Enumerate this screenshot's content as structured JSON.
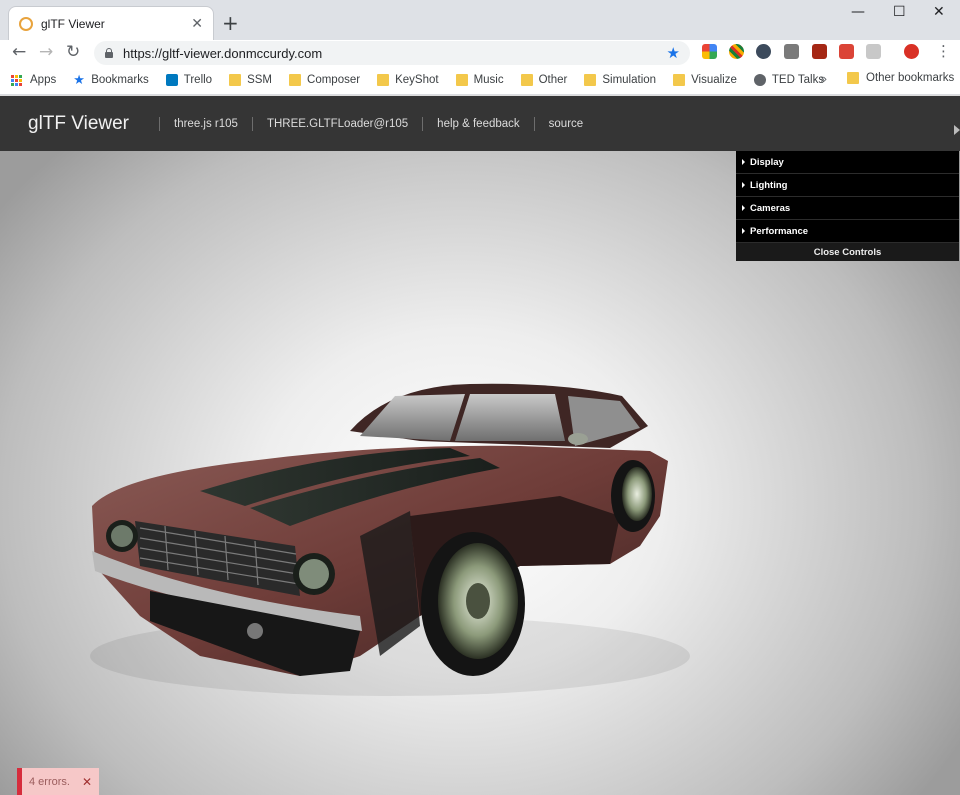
{
  "browser": {
    "tab_title": "glTF Viewer",
    "url": "https://gltf-viewer.donmccurdy.com",
    "window_controls": {
      "minimize": "—",
      "maximize": "☐",
      "close": "✕"
    },
    "new_tab": "+",
    "tab_close": "✕"
  },
  "bookmarks": {
    "apps": "Apps",
    "items": [
      "Bookmarks",
      "Trello",
      "SSM",
      "Composer",
      "KeyShot",
      "Music",
      "Other",
      "Simulation",
      "Visualize",
      "TED Talks"
    ],
    "overflow": "»",
    "other": "Other bookmarks"
  },
  "app": {
    "brand": "glTF Viewer",
    "links": [
      "three.js r105",
      "THREE.GLTFLoader@r105",
      "help & feedback",
      "source"
    ]
  },
  "controls": {
    "folders": [
      "Display",
      "Lighting",
      "Cameras",
      "Performance"
    ],
    "close_label": "Close Controls"
  },
  "errors": {
    "label": "4 errors.",
    "close": "✕"
  },
  "colors": {
    "accent_blue": "#1a73e8",
    "app_header": "#353535",
    "error_bg": "#f6c8c8",
    "error_border": "#d62d3d"
  }
}
